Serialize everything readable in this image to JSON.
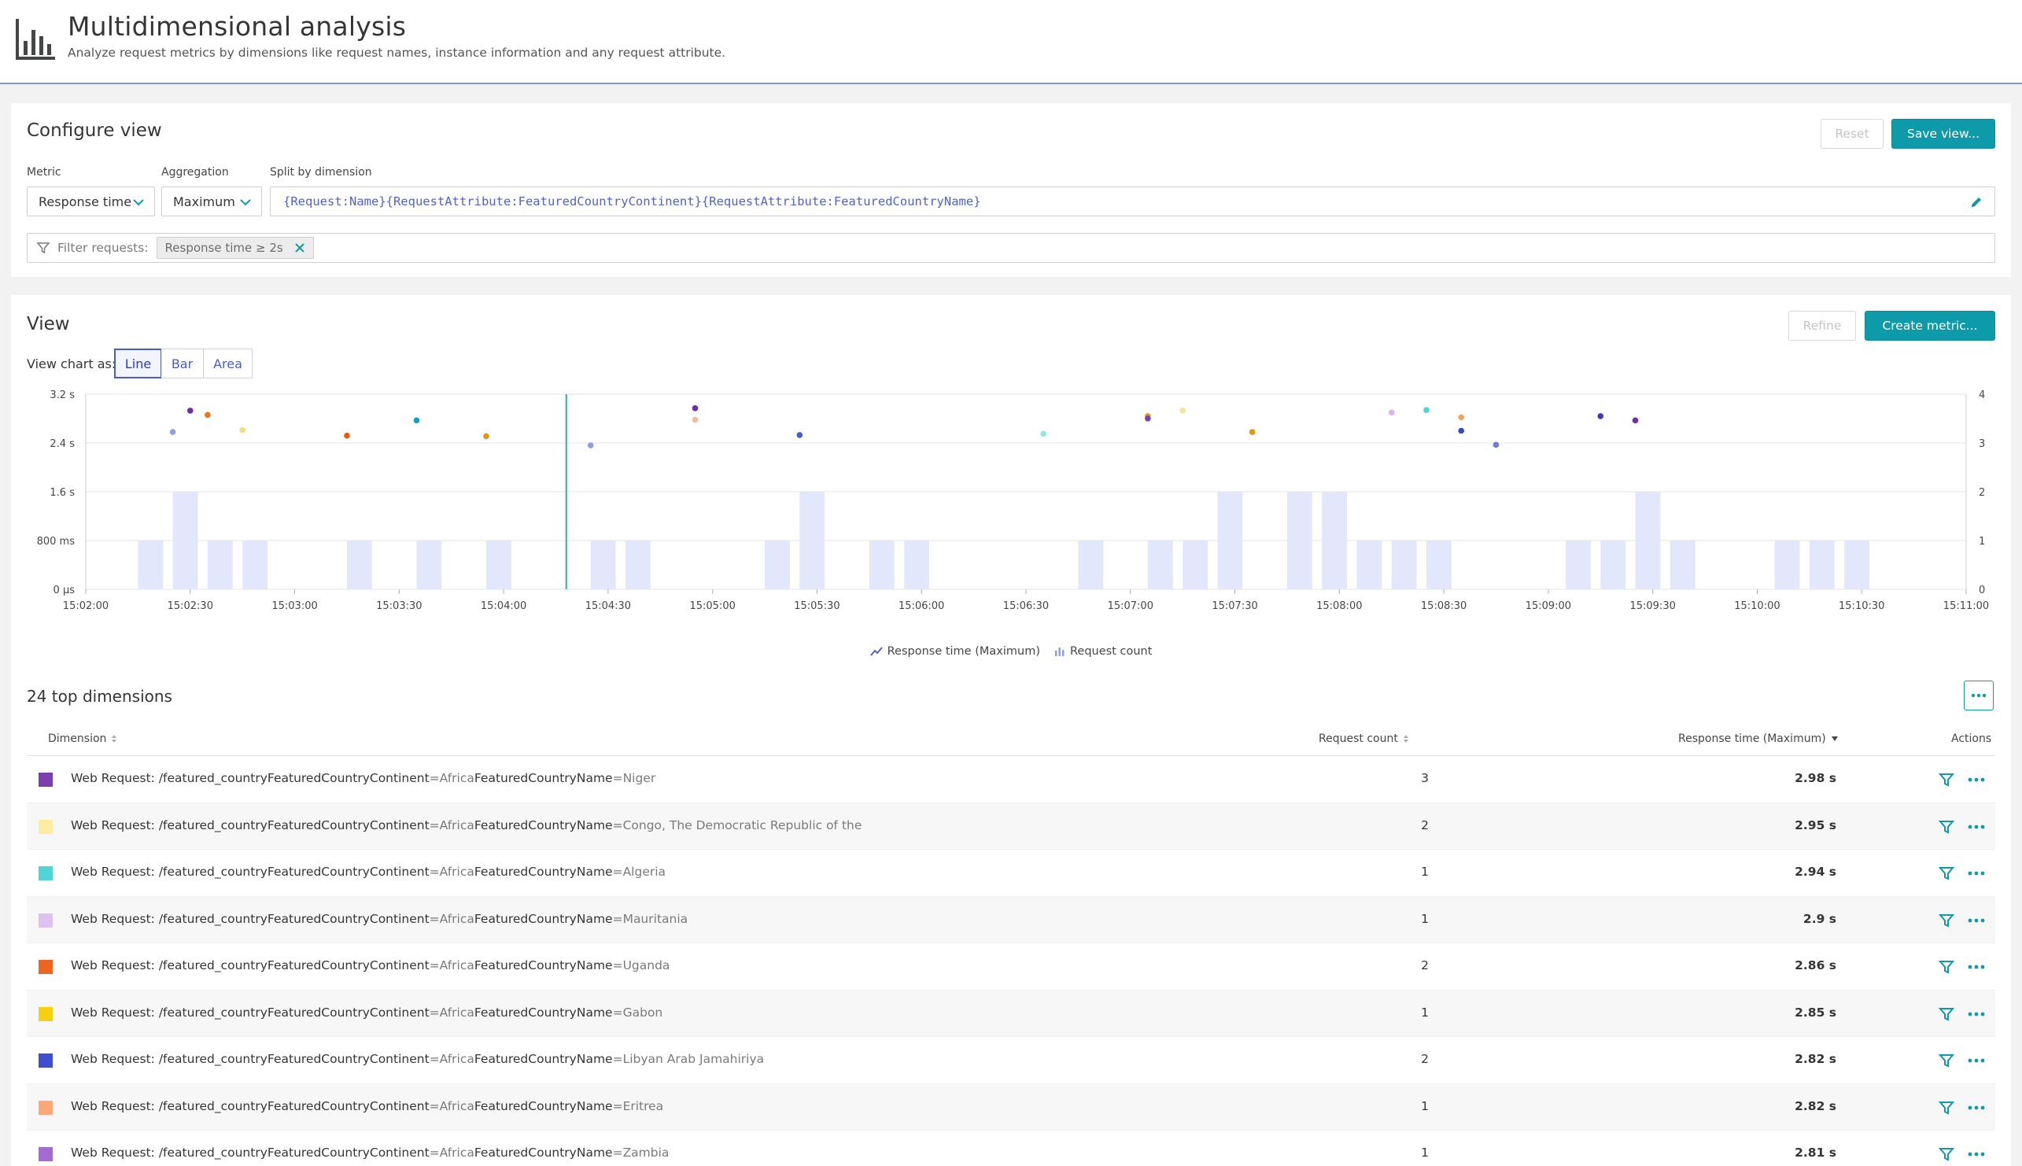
{
  "header": {
    "title": "Multidimensional analysis",
    "subtitle": "Analyze request metrics by dimensions like request names, instance information and any request attribute.",
    "logo_icon": "bar-chart-icon"
  },
  "config": {
    "title": "Configure view",
    "reset_label": "Reset",
    "save_label": "Save view...",
    "metric_label": "Metric",
    "metric_value": "Response time",
    "aggregation_label": "Aggregation",
    "aggregation_value": "Maximum",
    "split_label": "Split by dimension",
    "split_value": "{Request:Name}{RequestAttribute:FeaturedCountryContinent}{RequestAttribute:FeaturedCountryName}",
    "filter_label": "Filter requests:",
    "filter_chip": "Response time ≥ 2s"
  },
  "view": {
    "title": "View",
    "refine_label": "Refine",
    "create_metric_label": "Create metric...",
    "chart_as_label": "View chart as:",
    "chart_types": [
      "Line",
      "Bar",
      "Area"
    ],
    "active_chart_type": "Line",
    "legend": [
      "Response time (Maximum)",
      "Request count"
    ],
    "dims_count_label": "24 top dimensions",
    "more_icon": "ellipsis-icon"
  },
  "chart_data": {
    "type": "bar",
    "x": [
      "15:02:00",
      "15:02:30",
      "15:03:00",
      "15:03:30",
      "15:04:00",
      "15:04:30",
      "15:05:00",
      "15:05:30",
      "15:06:00",
      "15:06:30",
      "15:07:00",
      "15:07:30",
      "15:08:00",
      "15:08:30",
      "15:09:00",
      "15:09:30",
      "15:10:00",
      "15:10:30",
      "15:11:00"
    ],
    "y_left_ticks": [
      "0 µs",
      "800 ms",
      "1.6 s",
      "2.4 s",
      "3.2 s"
    ],
    "y_left_range_s": [
      0,
      3.2
    ],
    "y_right_ticks": [
      "0",
      "1",
      "2",
      "3",
      "4"
    ],
    "y_right_range": [
      0,
      4
    ],
    "bucket_seconds": 10,
    "request_count_series": {
      "name": "Request count",
      "start": "15:02:00",
      "counts": [
        0,
        1,
        2,
        1,
        1,
        0,
        0,
        1,
        0,
        1,
        0,
        1,
        0,
        0,
        1,
        1,
        0,
        0,
        0,
        1,
        2,
        0,
        1,
        1,
        0,
        0,
        0,
        0,
        1,
        0,
        1,
        1,
        2,
        0,
        2,
        2,
        1,
        1,
        1,
        0,
        0,
        0,
        1,
        1,
        2,
        1,
        0,
        0,
        1,
        1,
        1,
        0,
        0,
        0,
        0,
        0,
        0,
        0,
        0,
        0
      ]
    },
    "response_time_series": {
      "name": "Response time (Maximum)",
      "points": [
        {
          "t": "15:02:20",
          "v": 2.58,
          "color": "#8c9fe8"
        },
        {
          "t": "15:02:25",
          "v": 2.93,
          "color": "#6d2ea8"
        },
        {
          "t": "15:02:30",
          "v": 2.86,
          "color": "#e07b1f"
        },
        {
          "t": "15:02:40",
          "v": 2.61,
          "color": "#f2e07a"
        },
        {
          "t": "15:03:10",
          "v": 2.52,
          "color": "#e25c14"
        },
        {
          "t": "15:03:30",
          "v": 2.77,
          "color": "#15a3b8"
        },
        {
          "t": "15:03:50",
          "v": 2.51,
          "color": "#d89a17"
        },
        {
          "t": "15:04:20",
          "v": 2.36,
          "color": "#8c9fe8"
        },
        {
          "t": "15:04:50",
          "v": 2.97,
          "color": "#6d2ea8"
        },
        {
          "t": "15:04:50",
          "v": 2.78,
          "color": "#f4b9a0"
        },
        {
          "t": "15:05:20",
          "v": 2.53,
          "color": "#4a5bcc"
        },
        {
          "t": "15:06:30",
          "v": 2.55,
          "color": "#8ee8e0"
        },
        {
          "t": "15:07:00",
          "v": 2.84,
          "color": "#d89a17"
        },
        {
          "t": "15:07:00",
          "v": 2.8,
          "color": "#7a3fb0"
        },
        {
          "t": "15:07:10",
          "v": 2.93,
          "color": "#f7e3a0"
        },
        {
          "t": "15:07:30",
          "v": 2.58,
          "color": "#d89a17"
        },
        {
          "t": "15:08:10",
          "v": 2.9,
          "color": "#d9b3ef"
        },
        {
          "t": "15:08:20",
          "v": 2.94,
          "color": "#4fd4d8"
        },
        {
          "t": "15:08:30",
          "v": 2.82,
          "color": "#f4a460"
        },
        {
          "t": "15:08:30",
          "v": 2.6,
          "color": "#3347c7"
        },
        {
          "t": "15:08:40",
          "v": 2.37,
          "color": "#6b7fd7"
        },
        {
          "t": "15:09:10",
          "v": 2.84,
          "color": "#4a36b8"
        },
        {
          "t": "15:09:20",
          "v": 2.77,
          "color": "#6d2ea8"
        }
      ]
    },
    "cursor_time": "15:04:18"
  },
  "table": {
    "headers": {
      "dimension": "Dimension",
      "request_count": "Request count",
      "response_time": "Response time (Maximum)",
      "actions": "Actions"
    },
    "rows": [
      {
        "prefix": "Web Request: /featured_country",
        "k1": "FeaturedCountryContinent",
        "v1": "=Africa",
        "k2": "FeaturedCountryName",
        "v2": "=Niger",
        "count": "3",
        "resp": "2.98 s",
        "color": "#7b3fb0"
      },
      {
        "prefix": "Web Request: /featured_country",
        "k1": "FeaturedCountryContinent",
        "v1": "=Africa",
        "k2": "FeaturedCountryName",
        "v2": "=Congo, The Democratic Republic of the",
        "count": "2",
        "resp": "2.95 s",
        "color": "#fbeea1"
      },
      {
        "prefix": "Web Request: /featured_country",
        "k1": "FeaturedCountryContinent",
        "v1": "=Africa",
        "k2": "FeaturedCountryName",
        "v2": "=Algeria",
        "count": "1",
        "resp": "2.94 s",
        "color": "#4fd4d8"
      },
      {
        "prefix": "Web Request: /featured_country",
        "k1": "FeaturedCountryContinent",
        "v1": "=Africa",
        "k2": "FeaturedCountryName",
        "v2": "=Mauritania",
        "count": "1",
        "resp": "2.9 s",
        "color": "#dcc2f0"
      },
      {
        "prefix": "Web Request: /featured_country",
        "k1": "FeaturedCountryContinent",
        "v1": "=Africa",
        "k2": "FeaturedCountryName",
        "v2": "=Uganda",
        "count": "2",
        "resp": "2.86 s",
        "color": "#ef6420"
      },
      {
        "prefix": "Web Request: /featured_country",
        "k1": "FeaturedCountryContinent",
        "v1": "=Africa",
        "k2": "FeaturedCountryName",
        "v2": "=Gabon",
        "count": "1",
        "resp": "2.85 s",
        "color": "#f5cf10"
      },
      {
        "prefix": "Web Request: /featured_country",
        "k1": "FeaturedCountryContinent",
        "v1": "=Africa",
        "k2": "FeaturedCountryName",
        "v2": "=Libyan Arab Jamahiriya",
        "count": "2",
        "resp": "2.82 s",
        "color": "#3f4fd0"
      },
      {
        "prefix": "Web Request: /featured_country",
        "k1": "FeaturedCountryContinent",
        "v1": "=Africa",
        "k2": "FeaturedCountryName",
        "v2": "=Eritrea",
        "count": "1",
        "resp": "2.82 s",
        "color": "#ffa877"
      },
      {
        "prefix": "Web Request: /featured_country",
        "k1": "FeaturedCountryContinent",
        "v1": "=Africa",
        "k2": "FeaturedCountryName",
        "v2": "=Zambia",
        "count": "1",
        "resp": "2.81 s",
        "color": "#a56bd1"
      }
    ]
  }
}
